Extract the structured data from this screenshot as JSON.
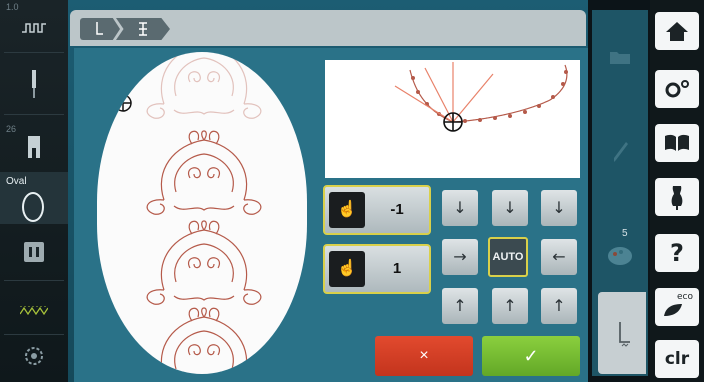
{
  "left_sidebar": {
    "items": [
      {
        "number": "1.0",
        "icon": "needle-position-icon"
      },
      {
        "number": "",
        "icon": "needle-icon"
      },
      {
        "number": "26",
        "icon": "presser-foot-icon"
      },
      {
        "label": "Oval",
        "icon": "oval-hoop-icon",
        "active": true
      },
      {
        "number": "",
        "icon": "stitch-plate-icon"
      },
      {
        "number": "",
        "icon": "zigzag-icon"
      },
      {
        "number": "",
        "icon": "bobbin-icon"
      }
    ]
  },
  "breadcrumb": {
    "items": [
      "needle-stitch-icon",
      "hoop-icon"
    ]
  },
  "controls": {
    "value_top": "-1",
    "value_bottom": "1",
    "auto_label": "AUTO",
    "arrows": {
      "down": "↓",
      "right": "→",
      "left": "←",
      "up": "↑"
    },
    "cancel_glyph": "×",
    "confirm_glyph": "✓"
  },
  "right_column": {
    "badge": "5"
  },
  "toolbar": {
    "home": "home-icon",
    "setup": "setup-gears-icon",
    "tutorial": "tutorial-book-icon",
    "consultant": "dress-form-icon",
    "help_label": "?",
    "eco_label": "eco",
    "clr_label": "clr"
  },
  "colors": {
    "panel": "#1c5d73",
    "highlight": "#d9d04a",
    "cancel": "#d63d24",
    "confirm": "#74bb30",
    "stitch": "#b55a4a"
  }
}
